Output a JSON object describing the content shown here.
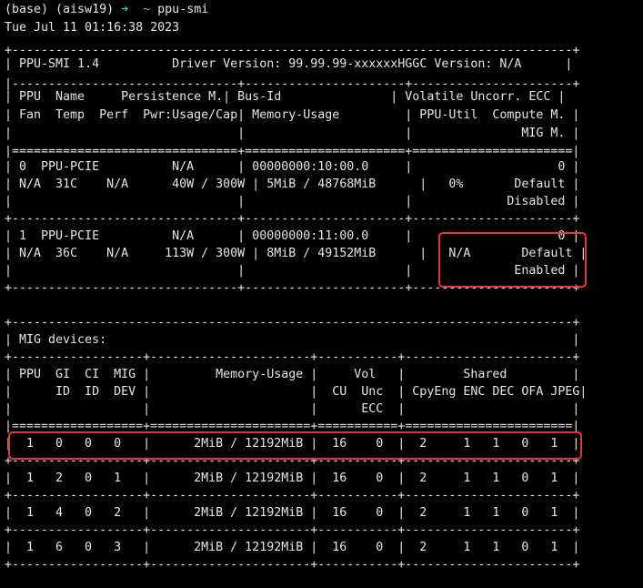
{
  "prompt": {
    "env": "(base) (aisw19)",
    "arrow": "➜",
    "cwd": "~",
    "command": "ppu-smi"
  },
  "timestamp": "Tue Jul 11 01:16:38 2023",
  "lines": [
    "+-----------------------------------------------------------------------------+",
    "| PPU-SMI 1.4          Driver Version: 99.99.99-xxxxxxHGGC Version: N/A      |",
    "|-------------------------------+----------------------+----------------------+",
    "| PPU  Name     Persistence M.| Bus-Id               | Volatile Uncorr. ECC |",
    "| Fan  Temp  Perf  Pwr:Usage/Cap| Memory-Usage         | PPU-Util  Compute M. |",
    "|                               |                      |               MIG M. |",
    "|===============================+======================+======================|",
    "| 0  PPU-PCIE          N/A      | 00000000:10:00.0     |                    0 |",
    "| N/A  31C    N/A      40W / 300W | 5MiB / 48768MiB      |   0%       Default |",
    "|                               |                      |             Disabled |",
    "+-------------------------------+----------------------+----------------------+",
    "| 1  PPU-PCIE          N/A      | 00000000:11:00.0     |                    0 |",
    "| N/A  36C    N/A     113W / 300W | 8MiB / 49152MiB      |   N/A       Default |",
    "|                               |                      |              Enabled |",
    "+-------------------------------+----------------------+----------------------+",
    "",
    "+-----------------------------------------------------------------------------+",
    "| MIG devices:                                                                |",
    "+------------------+----------------------+-----------+-----------------------+",
    "| PPU  GI  CI  MIG |         Memory-Usage |     Vol   |        Shared         |",
    "|      ID  ID  DEV |                      |  CU  Unc  | CpyEng ENC DEC OFA JPEG|",
    "|                  |                      |      ECC  |                       |",
    "|==================+======================+===========+=======================|",
    "|  1   0   0   0   |      2MiB / 12192MiB |  16    0  |  2     1   1   0   1  |",
    "+------------------+----------------------+-----------+-----------------------+",
    "|  1   2   0   1   |      2MiB / 12192MiB |  16    0  |  2     1   1   0   1  |",
    "+------------------+----------------------+-----------+-----------------------+",
    "|  1   4   0   2   |      2MiB / 12192MiB |  16    0  |  2     1   1   0   1  |",
    "+------------------+----------------------+-----------+-----------------------+",
    "|  1   6   0   3   |      2MiB / 12192MiB |  16    0  |  2     1   1   0   1  |",
    "+------------------+----------------------+-----------+-----------------------+"
  ],
  "colors": {
    "background": "#000000",
    "text": "#e6e6e6",
    "prompt_arrow": "#3fd27a",
    "prompt_tilde": "#4fd3e3",
    "highlight": "#e03a3a"
  }
}
